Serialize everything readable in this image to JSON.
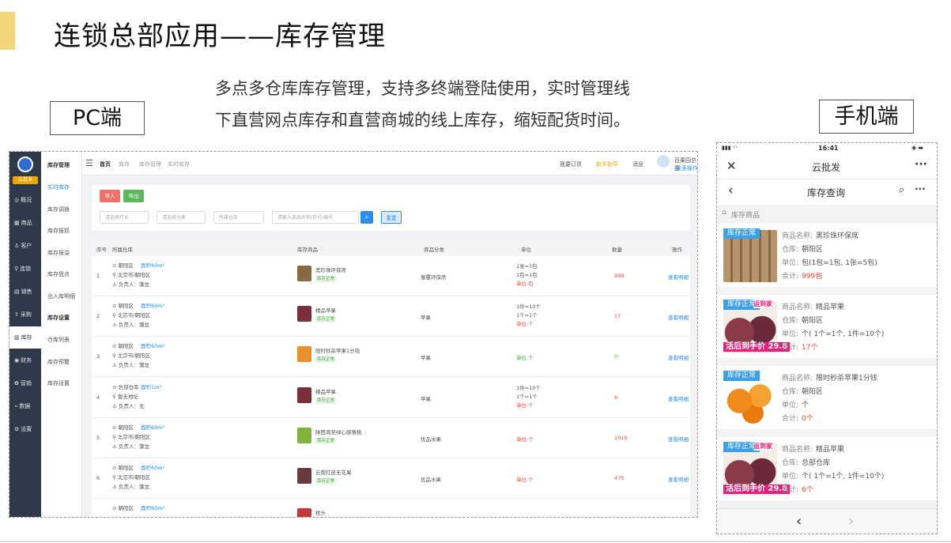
{
  "slide": {
    "title": "连锁总部应用——库存管理",
    "desc_line1": "多点多仓库库存管理，支持多终端登陆使用，实时管理线",
    "desc_line2": "下直营网点库存和直营商城的线上库存，缩短配货时间。",
    "pc_label": "PC端",
    "mobile_label": "手机端"
  },
  "pc": {
    "logo_text": "云批发",
    "side_items": [
      "概况",
      "商品",
      "客户",
      "连锁",
      "销售",
      "采购",
      "库存",
      "财务",
      "营销",
      "数据",
      "设置"
    ],
    "sub_groups": [
      "库存管理",
      "库存设置"
    ],
    "sub_items": [
      "实时库存",
      "库存调拨",
      "库存报损",
      "库存报溢",
      "库存盘点",
      "出入库明细"
    ],
    "sub_items2": [
      "仓库列表",
      "库存预警",
      "库存设置"
    ],
    "breadcrumb": [
      "首页",
      "库存",
      "库存管理",
      "实时库存"
    ],
    "top_right": [
      "我要订货",
      "新手指导",
      "消息",
      "百果园总部",
      "更多操作"
    ],
    "buttons": {
      "import": "导入",
      "export": "导出",
      "reset": "重置"
    },
    "filters": [
      "请选择行业",
      "请选择分类",
      "所属仓库",
      "请输入商品名称/货号/编号"
    ],
    "columns": [
      "序号",
      "所属仓库",
      "库存商品",
      "商品分类",
      "单位",
      "数量",
      "操作"
    ],
    "rows": [
      {
        "no": "1",
        "warehouse": "朝阳区",
        "area": "面积60m²",
        "city": "北京市/朝阳区",
        "manager": "负责人：蒲龙",
        "product": "黑珍珠环保席",
        "status": "库存正常",
        "category": "御璽环保席",
        "units": [
          "1张=5包",
          "1包=1包",
          "单位:包"
        ],
        "qty": "999",
        "action": "查看明细"
      },
      {
        "no": "2",
        "warehouse": "朝阳区",
        "area": "面积60m²",
        "city": "北京市/朝阳区",
        "manager": "负责人：蒲龙",
        "product": "精品苹果",
        "status": "库存正常",
        "category": "苹果",
        "units": [
          "1件=10个",
          "1个=1个",
          "单位:个"
        ],
        "qty": "17",
        "action": "查看明细"
      },
      {
        "no": "3",
        "warehouse": "朝阳区",
        "area": "面积60m²",
        "city": "北京市/朝阳区",
        "manager": "负责人：蒲龙",
        "product": "限时秒杀苹果1分钱",
        "status": "库存正常",
        "category": "苹果",
        "units": [
          "单位:个"
        ],
        "qty": "0",
        "action": "查看明细"
      },
      {
        "no": "4",
        "warehouse": "总部仓库",
        "area": "面积1m²",
        "city": "暂无地址",
        "manager": "负责人：无",
        "product": "精品苹果",
        "status": "库存正常",
        "category": "苹果",
        "units": [
          "1件=10个",
          "1个=1个",
          "单位:个"
        ],
        "qty": "6",
        "action": "查看明细"
      },
      {
        "no": "5",
        "warehouse": "朝阳区",
        "area": "面积60m²",
        "city": "北京市/朝阳区",
        "manager": "负责人：蒲龙",
        "product": "陕西周至绿心猕猴桃",
        "status": "库存正常",
        "category": "优品水果",
        "units": [
          "单位:个"
        ],
        "qty": "1010",
        "action": "查看明细"
      },
      {
        "no": "6",
        "warehouse": "朝阳区",
        "area": "面积60m²",
        "city": "北京市/朝阳区",
        "manager": "负责人：蒲龙",
        "product": "云南红皮无花果",
        "status": "库存正常",
        "category": "优品水果",
        "units": [
          "单位:个"
        ],
        "qty": "475",
        "action": "查看明细"
      },
      {
        "no": "",
        "warehouse": "朝阳区",
        "area": "面积60m²",
        "city": "",
        "manager": "",
        "product": "枕头",
        "status": "",
        "category": "",
        "units": [],
        "qty": "",
        "action": ""
      }
    ],
    "colors": {
      "sidebar": "#2e3a4a",
      "accent": "#2b8ee8",
      "import_btn": "#f0706a",
      "export_btn": "#5cb85c"
    }
  },
  "mobile": {
    "time": "16:41",
    "app_title": "云批发",
    "page_title": "库存查询",
    "crumb": "库存商品",
    "cards": [
      {
        "badge": "库存正常",
        "name_label": "商品名称:",
        "name": "黑珍珠环保席",
        "wh_label": "仓库:",
        "wh": "朝阳区",
        "unit_label": "单位:",
        "unit": "包(1包=1包, 1张=5包)",
        "total_label": "合计:",
        "total": "999包",
        "img": "mats"
      },
      {
        "badge": "库存正常",
        "name_label": "商品名称:",
        "name": "精品苹果",
        "wh_label": "仓库:",
        "wh": "朝阳区",
        "unit_label": "单位:",
        "unit": "个( 1个=1个, 1件=10个)",
        "total_label": "合计:",
        "total": "17个",
        "img": "apple",
        "promo": "活后到手价 29.8",
        "promo_top": "运到家"
      },
      {
        "badge": "库存正常",
        "name_label": "商品名称:",
        "name": "限时秒杀苹果1分钱",
        "wh_label": "仓库:",
        "wh": "朝阳区",
        "unit_label": "单位:",
        "unit": "个",
        "total_label": "合计:",
        "total": "0个",
        "img": "orange"
      },
      {
        "badge": "库存正常",
        "name_label": "商品名称:",
        "name": "精品苹果",
        "wh_label": "仓库:",
        "wh": "总部仓库",
        "unit_label": "单位:",
        "unit": "个( 1个=1个, 1件=10个)",
        "total_label": "合计:",
        "total": "6个",
        "img": "apple",
        "promo": "活后到手价 29.8",
        "promo_top": "运到家"
      }
    ]
  }
}
